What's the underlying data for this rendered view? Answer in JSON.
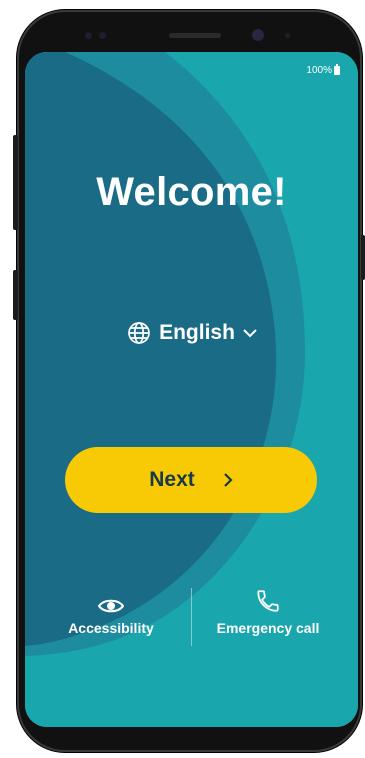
{
  "status_bar": {
    "battery_text": "100%",
    "battery_icon": "battery-full-icon"
  },
  "welcome": {
    "title": "Welcome!"
  },
  "language": {
    "label": "English",
    "icon": "globe-icon",
    "dropdown_icon": "chevron-down-icon"
  },
  "next_button": {
    "label": "Next",
    "icon": "chevron-right-icon"
  },
  "footer": {
    "accessibility": {
      "label": "Accessibility",
      "icon": "eye-icon"
    },
    "emergency": {
      "label": "Emergency call",
      "icon": "phone-icon"
    }
  },
  "colors": {
    "screen_bg": "#1aa6ad",
    "wave_dark": "#1a6b86",
    "wave_mid": "#1d8c9f",
    "button": "#f8c905",
    "button_text": "#173a47"
  }
}
